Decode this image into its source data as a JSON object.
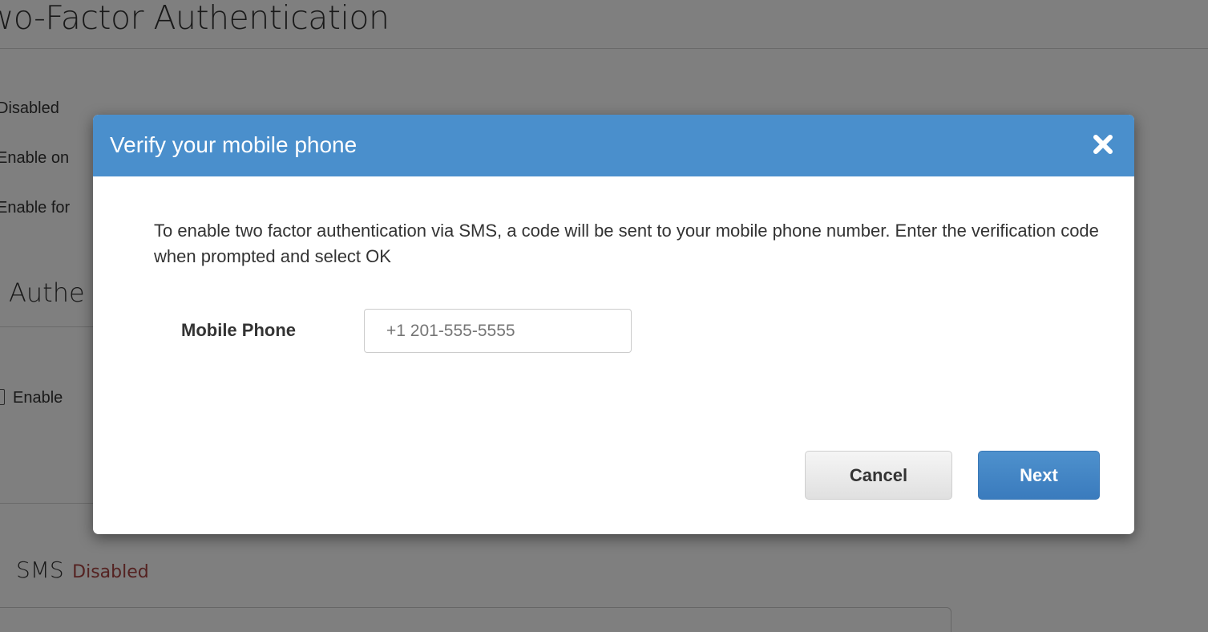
{
  "background": {
    "page_title": "Two-Factor Authentication",
    "options": [
      "Disabled",
      "Enable on",
      "Enable for"
    ],
    "section_title": "Authe",
    "checkbox_label": "Enable",
    "sms_label": "SMS",
    "sms_status": "Disabled"
  },
  "modal": {
    "title": "Verify your mobile phone",
    "close_icon": "close-icon",
    "description": "To enable two factor authentication via SMS, a code will be sent to your mobile phone number. Enter the verification code when prompted and select OK",
    "phone_label": "Mobile Phone",
    "phone_placeholder": "+1 201-555-5555",
    "cancel_label": "Cancel",
    "next_label": "Next"
  },
  "colors": {
    "header": "#4a8fcc",
    "next_button": "#3f83c4",
    "status_disabled": "#a94442"
  }
}
